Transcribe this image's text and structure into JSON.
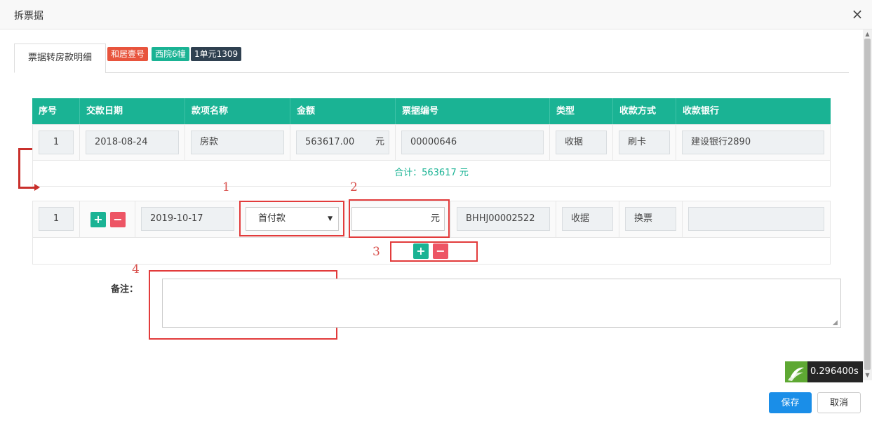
{
  "dialog": {
    "title": "拆票据",
    "close_icon": "×"
  },
  "tabs": [
    {
      "label": "票据转房款明细"
    }
  ],
  "badges": [
    {
      "label": "和居壹号",
      "color": "#e8543d"
    },
    {
      "label": "西院6幢",
      "color": "#1ab394"
    },
    {
      "label": "1单元1309",
      "color": "#2f4050"
    }
  ],
  "table": {
    "headers": [
      "序号",
      "交款日期",
      "款项名称",
      "金额",
      "票据编号",
      "类型",
      "收款方式",
      "收款银行"
    ],
    "row": {
      "index": "1",
      "date": "2018-08-24",
      "item": "房款",
      "amount": "563617.00",
      "unit": "元",
      "receipt_no": "00000646",
      "type": "收据",
      "method": "刷卡",
      "bank": "建设银行2890"
    },
    "total_label": "合计：563617 元"
  },
  "split_row": {
    "index": "1",
    "add_icon": "+",
    "remove_icon": "−",
    "date": "2019-10-17",
    "item_selected": "首付款",
    "amount_value": "",
    "unit": "元",
    "receipt_no": "BHHJ00002522",
    "type": "收据",
    "method": "换票",
    "bank": ""
  },
  "annotations": [
    "1",
    "2",
    "3",
    "4"
  ],
  "remark": {
    "label": "备注：",
    "value": ""
  },
  "timer": {
    "value": "0.296400s"
  },
  "footer": {
    "save_label": "保存",
    "cancel_label": "取消"
  },
  "colors": {
    "accent": "#1ab394",
    "danger": "#ed5565",
    "primary": "#1a8ee8",
    "annotation": "#e23b3b"
  }
}
